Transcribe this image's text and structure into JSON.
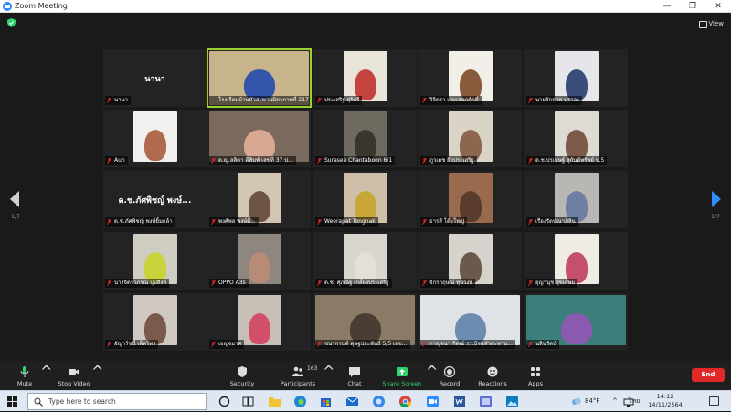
{
  "window": {
    "title": "Zoom Meeting"
  },
  "topbar": {
    "view_label": "View"
  },
  "pager": {
    "left_count": "1/7",
    "right_count": "1/7"
  },
  "colors": {
    "accent": "#2d8cff",
    "active_speaker": "#9bd12e",
    "share_green": "#2bd46e",
    "end_red": "#e02828",
    "muted_mic": "#e02828"
  },
  "participants": [
    {
      "name": "นานา",
      "card": "นานา",
      "video": false,
      "muted": true
    },
    {
      "name": "โรงเรียนบ้านหัวสะพานมิตรภาพที่ 217",
      "video": true,
      "muted": false,
      "active": true,
      "bg": "#c8b48a",
      "fg": "#3355aa"
    },
    {
      "name": "ประเสริฐ   สุริศรี",
      "video": true,
      "muted": true,
      "bg": "#e9e4d9",
      "fg": "#c4433f"
    },
    {
      "name": "วิจิตรา   เกษเอนกศักดิ์",
      "video": true,
      "muted": true,
      "bg": "#f2efe8",
      "fg": "#8a5a3c"
    },
    {
      "name": "นายจักรภพ ปุราจะ",
      "video": true,
      "muted": true,
      "bg": "#e6e6ea",
      "fg": "#3a4e7c"
    },
    {
      "name": "Aun",
      "video": true,
      "muted": true,
      "bg": "#f1f0ee",
      "fg": "#b06a4e"
    },
    {
      "name": "ด.ญ.ลลิตา   ดีพิมพ์   เลขที่ 37   ป...",
      "video": true,
      "muted": true,
      "bg": "#7a6a5e",
      "fg": "#d9a892"
    },
    {
      "name": "Surasee Chantaboon 6/1",
      "video": true,
      "muted": true,
      "bg": "#6f6a60",
      "fg": "#3b3530"
    },
    {
      "name": "ภูวเดช ผิวประเสริฐ",
      "video": true,
      "muted": true,
      "bg": "#d9d4c6",
      "fg": "#8d6650"
    },
    {
      "name": "ด.ช.ปรเมษฐ์ สุกันต์ทรัพย์ ป.5",
      "video": true,
      "muted": true,
      "bg": "#dedad4",
      "fg": "#7b5a49"
    },
    {
      "name": "ด.ช.ภัศพิชญ์ พงษ์ยิ้มกล้า",
      "card": "ด.ช.ภัศพิชญ์ พงษ์...",
      "video": false,
      "muted": true
    },
    {
      "name": "พงศ์พล พงษ์ดี...",
      "video": true,
      "muted": true,
      "bg": "#d2c5b4",
      "fg": "#6d5444"
    },
    {
      "name": "Weerapat Tongnak",
      "video": true,
      "muted": true,
      "bg": "#cdbfa8",
      "fg": "#c9a63a"
    },
    {
      "name": "ธารสี   โต๊ะใหญ่",
      "video": true,
      "muted": true,
      "bg": "#9a6a4e",
      "fg": "#5a3c2e"
    },
    {
      "name": "เรืองรัตน์ณาภิลิน",
      "video": true,
      "muted": true,
      "bg": "#b9b7b4",
      "fg": "#6f7ea3"
    },
    {
      "name": "นางจิตราภรณ์ ปุปสิงห์",
      "video": true,
      "muted": true,
      "bg": "#cfcdc2",
      "fg": "#c9d43a"
    },
    {
      "name": "OPPO A3s",
      "video": true,
      "muted": true,
      "bg": "#8e8780",
      "fg": "#b88b76"
    },
    {
      "name": "ด.ช. ศุภณัฐ   เกลี้ยงประเสริฐ",
      "video": true,
      "muted": true,
      "bg": "#d9d6d0",
      "fg": "#e3e0da"
    },
    {
      "name": "จักรกฤษณ์ ทุนวงษ์",
      "video": true,
      "muted": true,
      "bg": "#d6d3cd",
      "fg": "#6a5a4e"
    },
    {
      "name": "ยุญานุช สุขเกษม",
      "video": true,
      "muted": true,
      "bg": "#efece6",
      "fg": "#c4506e"
    },
    {
      "name": "อัญาร์ชนิ์ เด็ดไทร",
      "video": true,
      "muted": true,
      "bg": "#cfc9c1",
      "fg": "#7a5a4c"
    },
    {
      "name": "เยญจมาศ",
      "video": true,
      "muted": true,
      "bg": "#c8bfb7",
      "fg": "#d24f6a"
    },
    {
      "name": "ชนากานต์ ตุษฐประพันธ์ 5/5 เลข...",
      "video": true,
      "muted": true,
      "bg": "#8a7a66",
      "fg": "#4a3d33"
    },
    {
      "name": "กาญจนา กิตณ์ รร.บ้านหัวสะพาน...",
      "video": true,
      "muted": true,
      "bg": "#dfe3e8",
      "fg": "#6c8db0"
    },
    {
      "name": "นลินรัตน์",
      "video": true,
      "muted": true,
      "bg": "#3b7f7a",
      "fg": "#8a5ab0"
    }
  ],
  "toolbar": {
    "mute": "Mute",
    "stop_video": "Stop Video",
    "security": "Security",
    "participants": "Participants",
    "participants_count": "163",
    "chat": "Chat",
    "share_screen": "Share Screen",
    "record": "Record",
    "reactions": "Reactions",
    "apps": "Apps",
    "end": "End"
  },
  "taskbar": {
    "search_placeholder": "Type here to search",
    "weather": "84°F",
    "language": "ไทย",
    "time": "14:12",
    "date": "14/11/2564"
  }
}
